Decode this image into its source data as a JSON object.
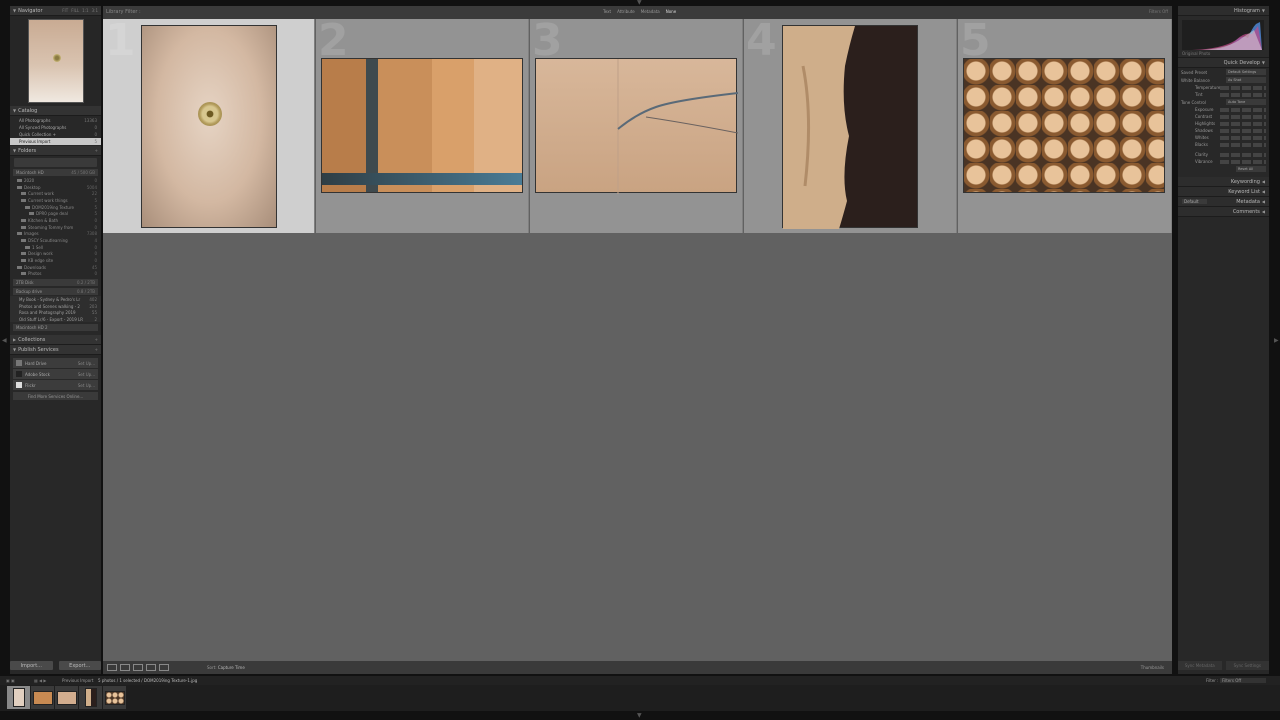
{
  "navigator": {
    "title": "Navigator",
    "zoom_options": [
      "FIT",
      "FILL",
      "1:1",
      "3:1"
    ]
  },
  "catalog": {
    "title": "Catalog",
    "items": [
      {
        "label": "All Photographs",
        "count": "13363"
      },
      {
        "label": "All Synced Photographs",
        "count": "0"
      },
      {
        "label": "Quick Collection +",
        "count": "0"
      },
      {
        "label": "Previous Import",
        "count": "5"
      }
    ]
  },
  "folders": {
    "title": "Folders",
    "volume": {
      "label": "Macintosh HD",
      "value": "45 / 500 GB"
    },
    "tree": [
      {
        "label": "2020",
        "count": "0",
        "indent": 1
      },
      {
        "label": "Desktop",
        "count": "5004",
        "indent": 1
      },
      {
        "label": "Current work",
        "count": "22",
        "indent": 2
      },
      {
        "label": "Current work things",
        "count": "5",
        "indent": 2
      },
      {
        "label": "DOM2019ing Texture",
        "count": "5",
        "indent": 3
      },
      {
        "label": "DPR0 page deal",
        "count": "5",
        "indent": 4
      },
      {
        "label": "Kitchen & Bath",
        "count": "0",
        "indent": 2
      },
      {
        "label": "Steaming Tommy from",
        "count": "0",
        "indent": 2
      },
      {
        "label": "Images",
        "count": "7308",
        "indent": 1
      },
      {
        "label": "DSCY Scoutlearning",
        "count": "4",
        "indent": 2
      },
      {
        "label": "1 Sell",
        "count": "0",
        "indent": 3
      },
      {
        "label": "Design work",
        "count": "0",
        "indent": 2
      },
      {
        "label": "KB edge site",
        "count": "0",
        "indent": 2
      },
      {
        "label": "Downloads",
        "count": "45",
        "indent": 1
      },
      {
        "label": "Photos",
        "count": "0",
        "indent": 2
      }
    ]
  },
  "drive2": {
    "label": "2TB Disk",
    "value": "0.2 / 2TB"
  },
  "backup": {
    "label": "Backup drive",
    "value": "0.8 / 2TB",
    "items": [
      {
        "label": "My Book - Sydney & Pedro's Lr",
        "count": "402"
      },
      {
        "label": "Photos and Scenes walking - 2",
        "count": "203"
      },
      {
        "label": "Rosa and Photography 2019",
        "count": "55"
      },
      {
        "label": "Old Stuff Lr/6 - Export - 2019 LR",
        "count": "2"
      }
    ]
  },
  "drive3": {
    "label": "Macintosh HD 2"
  },
  "collections": {
    "title": "Collections"
  },
  "publish": {
    "title": "Publish Services",
    "services": [
      {
        "label": "Hard Drive",
        "action": "Set Up...",
        "logo_color": "#777777"
      },
      {
        "label": "Adobe Stock",
        "action": "Set Up...",
        "logo_color": "#222222"
      },
      {
        "label": "Flickr",
        "action": "Set Up...",
        "logo_color": "#dddddd"
      }
    ],
    "find_more": "Find More Services Online..."
  },
  "buttons": {
    "import": "Import...",
    "export": "Export..."
  },
  "filter_bar": {
    "title": "Library Filter :",
    "modes": [
      "Text",
      "Attribute",
      "Metadata",
      "None"
    ],
    "active": "None",
    "preset": "Filters Off"
  },
  "grid": {
    "cells": [
      {
        "number": "1",
        "selected": true
      },
      {
        "number": "2",
        "selected": false
      },
      {
        "number": "3",
        "selected": false
      },
      {
        "number": "4",
        "selected": false
      },
      {
        "number": "5",
        "selected": false
      }
    ]
  },
  "toolbar": {
    "sort_label": "Sort:",
    "sort_value": "Capture Time",
    "thumbnails_label": "Thumbnails"
  },
  "histogram": {
    "title": "Histogram",
    "info": "Original Photo"
  },
  "quick_develop": {
    "title": "Quick Develop",
    "saved_preset": {
      "label": "Saved Preset",
      "value": "Default Settings"
    },
    "white_balance": {
      "label": "White Balance",
      "value": "As Shot"
    },
    "wb_rows": [
      "Temperature",
      "Tint"
    ],
    "tone_control": {
      "label": "Tone Control",
      "value": "Auto Tone"
    },
    "tone_rows": [
      "Exposure",
      "Contrast",
      "Highlights",
      "Shadows",
      "Whites",
      "Blacks"
    ],
    "presence_rows": [
      "Clarity",
      "Vibrance"
    ],
    "reset": "Reset All"
  },
  "right_sections": {
    "keywording": "Keywording",
    "keyword_list": "Keyword List",
    "metadata": "Metadata",
    "metadata_preset": "Default",
    "comments": "Comments"
  },
  "sync": {
    "metadata": "Sync Metadata",
    "settings": "Sync Settings"
  },
  "filmstrip_bar": {
    "source": "Previous Import",
    "info": "5 photos / 1 selected / DOM2019ing Texture-1.jpg",
    "filter_label": "Filter :",
    "filter_value": "Filters Off"
  },
  "colors": {
    "panel_bg": "#282828",
    "grid_bg": "#616161",
    "cell_bg": "#939393",
    "cell_selected": "#cfcfcf"
  }
}
